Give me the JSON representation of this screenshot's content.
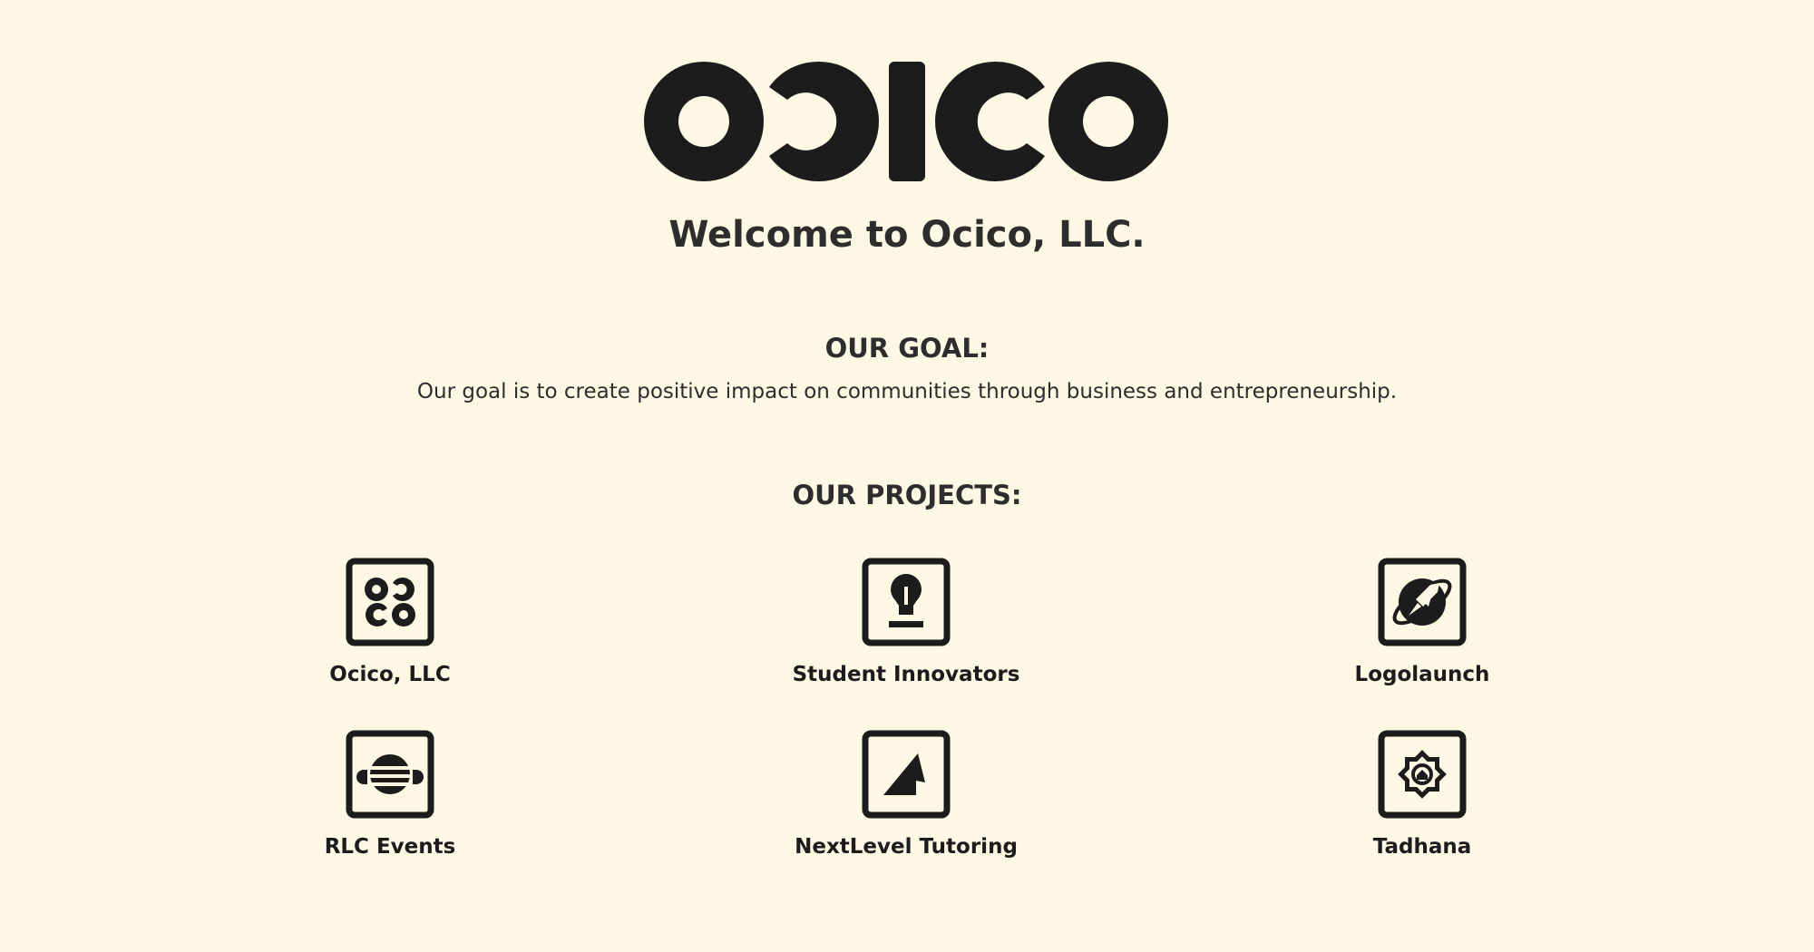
{
  "brand": {
    "logo_text": "OCICO"
  },
  "hero": {
    "welcome": "Welcome to Ocico, LLC."
  },
  "goal": {
    "title": "OUR GOAL:",
    "text": "Our goal is to create positive impact on communities through business and entrepreneurship."
  },
  "projects": {
    "title": "OUR PROJECTS:",
    "items": [
      {
        "name": "Ocico, LLC",
        "icon": "ocico-icon"
      },
      {
        "name": "Student Innovators",
        "icon": "lightbulb-icon"
      },
      {
        "name": "Logolaunch",
        "icon": "rocket-icon"
      },
      {
        "name": "RLC Events",
        "icon": "headphones-icon"
      },
      {
        "name": "NextLevel Tutoring",
        "icon": "triangle-icon"
      },
      {
        "name": "Tadhana",
        "icon": "house-star-icon"
      }
    ]
  },
  "colors": {
    "background": "#fdf8e4",
    "ink": "#1c1c1c"
  }
}
